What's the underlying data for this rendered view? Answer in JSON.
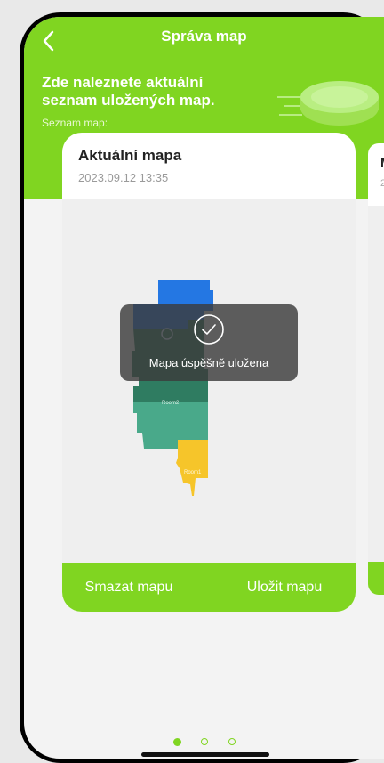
{
  "header": {
    "title": "Správa map",
    "subtitle": "Zde naleznete aktuální seznam uložených map.",
    "list_label": "Seznam map:"
  },
  "cards": [
    {
      "title": "Aktuální mapa",
      "date": "2023.09.12 13:35",
      "room_labels": [
        "Room2",
        "Room1"
      ],
      "delete_label": "Smazat mapu",
      "save_label": "Uložit mapu"
    },
    {
      "title": "M",
      "date": "2"
    }
  ],
  "toast": {
    "message": "Mapa úspěšně uložena"
  },
  "pagination": {
    "count": 3,
    "active_index": 0
  },
  "colors": {
    "accent": "#80d521",
    "room_blue": "#2477e3",
    "room_green": "#49a98a",
    "room_yellow": "#f6c52a",
    "toast_bg": "#3c3c3c"
  }
}
